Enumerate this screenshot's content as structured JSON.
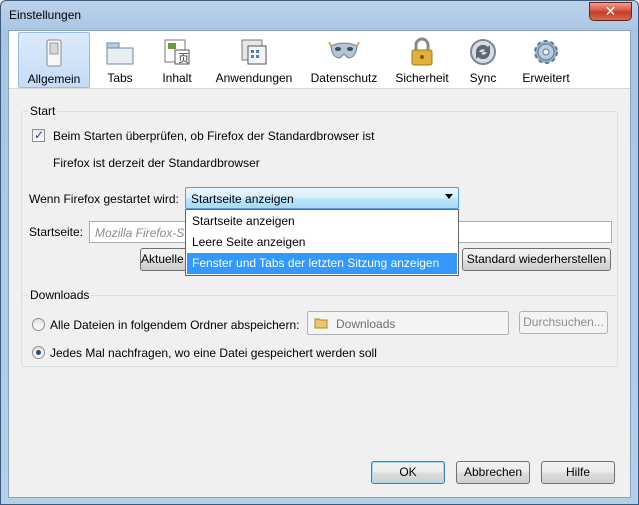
{
  "window": {
    "title": "Einstellungen",
    "close_label": "✕"
  },
  "tabs": [
    {
      "label": "Allgemein",
      "icon": "switch-icon",
      "selected": true
    },
    {
      "label": "Tabs",
      "icon": "tabs-icon"
    },
    {
      "label": "Inhalt",
      "icon": "content-icon"
    },
    {
      "label": "Anwendungen",
      "icon": "applications-icon"
    },
    {
      "label": "Datenschutz",
      "icon": "mask-icon"
    },
    {
      "label": "Sicherheit",
      "icon": "padlock-icon"
    },
    {
      "label": "Sync",
      "icon": "sync-icon"
    },
    {
      "label": "Erweitert",
      "icon": "gear-icon"
    }
  ],
  "start": {
    "legend": "Start",
    "check_default_label": "Beim Starten überprüfen, ob Firefox der Standardbrowser ist",
    "check_default_checked": true,
    "default_status": "Firefox ist derzeit der Standardbrowser",
    "when_start_label": "Wenn Firefox gestartet wird:",
    "when_start_value": "Startseite anzeigen",
    "dropdown_options": [
      "Startseite anzeigen",
      "Leere Seite anzeigen",
      "Fenster und Tabs der letzten Sitzung anzeigen"
    ],
    "dropdown_highlighted": 2,
    "homepage_label": "Startseite:",
    "homepage_placeholder": "Mozilla Firefox-Startseite",
    "current_pages_button": "Aktuelle Seiten verwenden",
    "restore_default_button": "Standard wiederherstellen"
  },
  "downloads": {
    "legend": "Downloads",
    "save_to_label": "Alle Dateien in folgendem Ordner abspeichern:",
    "folder_value": "Downloads",
    "browse_button": "Durchsuchen...",
    "ask_label": "Jedes Mal nachfragen, wo eine Datei gespeichert werden soll",
    "selected_option": "ask"
  },
  "footer": {
    "ok": "OK",
    "cancel": "Abbrechen",
    "help": "Hilfe"
  }
}
